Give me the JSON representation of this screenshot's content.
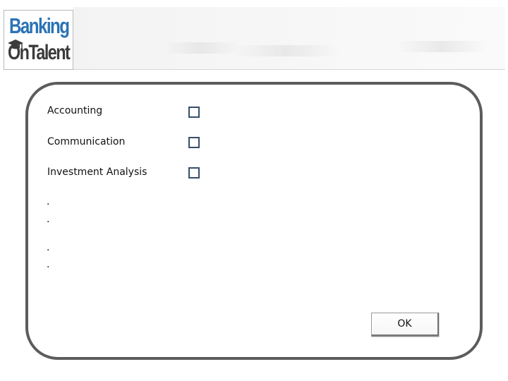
{
  "header": {
    "logo": {
      "line1": "Banking",
      "line2": "OnTalent",
      "primary_color": "#2b73b5",
      "secondary_color": "#3b3b3b"
    }
  },
  "form": {
    "options": [
      {
        "label": "Accounting",
        "checked": false
      },
      {
        "label": "Communication",
        "checked": false
      },
      {
        "label": "Investment Analysis",
        "checked": false
      }
    ],
    "ellipsis_marks": [
      ".",
      ".",
      ".",
      "."
    ],
    "ok_label": "OK"
  },
  "colors": {
    "panel_border": "#5c5c5c",
    "checkbox_border": "#374e6b"
  }
}
